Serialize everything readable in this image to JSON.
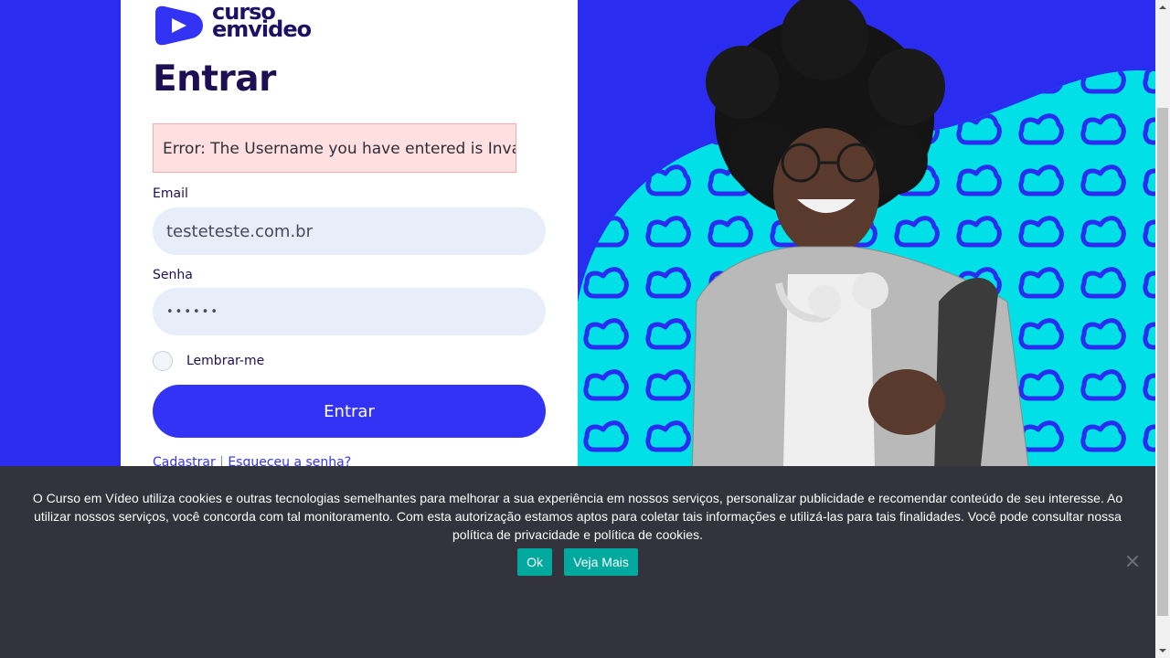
{
  "brand": {
    "line1": "curso",
    "line2": "emvideo",
    "colors": {
      "primary": "#3333f5",
      "dark": "#1d0f53",
      "background": "#2a2cf0",
      "accent_cyan": "#00e0e6",
      "cookie_button": "#00a99d"
    }
  },
  "login": {
    "title": "Entrar",
    "error_message": "Error: The Username you have entered is Invalid",
    "email_label": "Email",
    "email_value": "testeteste.com.br",
    "password_label": "Senha",
    "password_value": "••••••",
    "remember_label": "Lembrar-me",
    "submit_label": "Entrar",
    "register_link": "Cadastrar",
    "separator": " | ",
    "forgot_link": "Esqueceu a senha?"
  },
  "cookie": {
    "text": "O Curso em Vídeo utiliza cookies e outras tecnologias semelhantes para melhorar a sua experiência em nossos serviços, personalizar publicidade e recomendar conteúdo de seu interesse. Ao utilizar nossos serviços, você concorda com tal monitoramento. Com esta autorização estamos aptos para coletar tais informações e utilizá-las para tais finalidades. Você pode consultar nossa política de privacidade e política de cookies.",
    "ok_label": "Ok",
    "more_label": "Veja Mais",
    "close_icon": "close-icon"
  },
  "icons": {
    "logo": "play-icon",
    "close": "close-icon",
    "scroll_up": "chevron-up-icon",
    "scroll_down": "chevron-down-icon"
  }
}
